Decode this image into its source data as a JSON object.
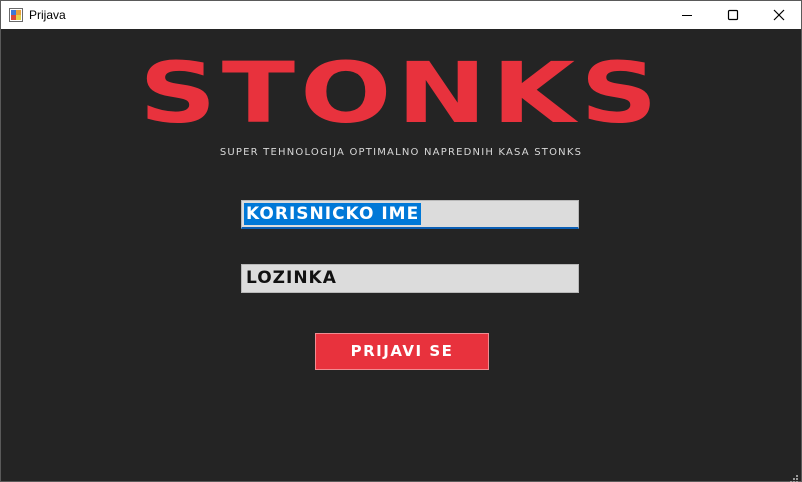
{
  "window": {
    "title": "Prijava",
    "controls": [
      "minimize-icon",
      "maximize-icon",
      "close-icon"
    ]
  },
  "branding": {
    "logo": "STONKS",
    "tagline": "SUPER TEHNOLOGIJA OPTIMALNO NAPREDNIH KASA STONKS",
    "accent_color": "#e8323d"
  },
  "form": {
    "username": {
      "value": "KORISNICKO IME",
      "selected": true
    },
    "password": {
      "value": "LOZINKA"
    },
    "submit_label": "PRIJAVI SE"
  },
  "colors": {
    "background": "#242424",
    "field_bg": "#dcdcdc",
    "selection": "#0078d7",
    "button": "#e8323d"
  }
}
